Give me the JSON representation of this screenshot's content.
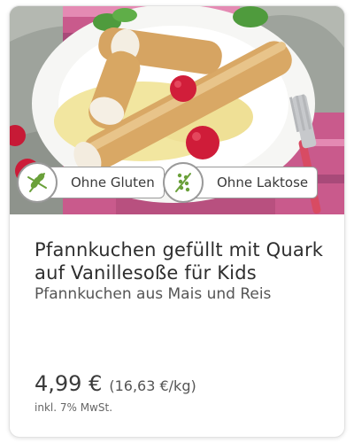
{
  "product": {
    "image_alt": "Pfannkuchen gefüllt mit Quark",
    "title": "Pfannkuchen gefüllt mit Quark auf Vanillesoße für Kids",
    "subtitle": "Pfannkuchen aus Mais und Reis",
    "price": "4,99 €",
    "unit_price": "(16,63 €/kg)",
    "vat_note": "inkl. 7% MwSt."
  },
  "badges": [
    {
      "label": "Ohne Gluten",
      "icon": "wheat-crossed-icon"
    },
    {
      "label": "Ohne Laktose",
      "icon": "milk-drops-icon"
    }
  ],
  "colors": {
    "badge_icon_green": "#6aa03a",
    "border": "#9a9a9a",
    "text": "#3a3a3a"
  }
}
